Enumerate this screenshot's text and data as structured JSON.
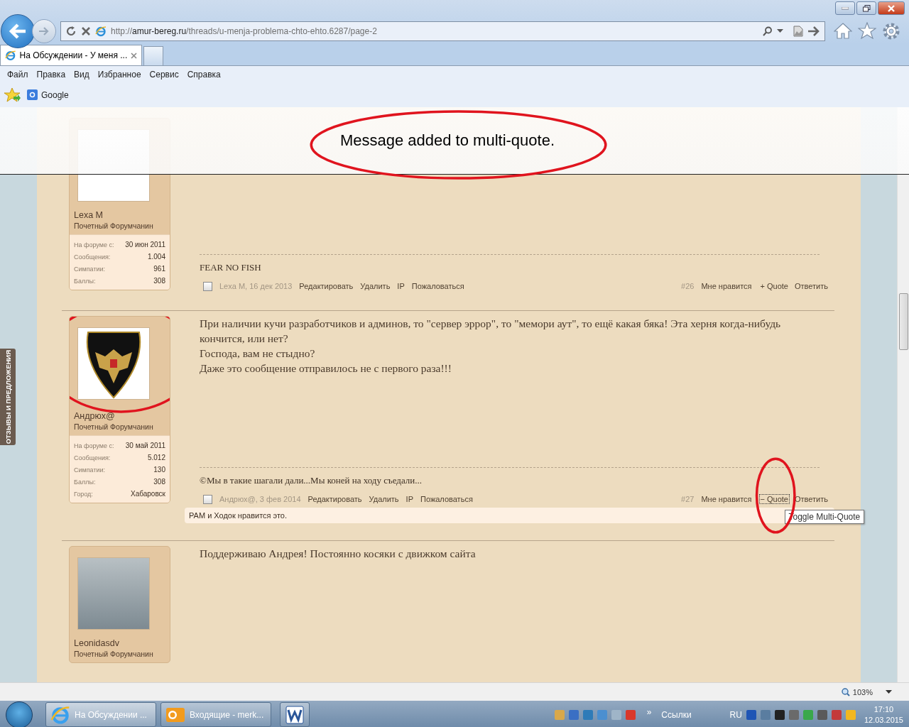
{
  "address_bar": {
    "url_scheme": "http://",
    "url_domain": "amur-bereg.ru",
    "url_path": "/threads/u-menja-problema-chto-ehto.6287/page-2"
  },
  "tabs": [
    {
      "title": "На Обсуждении - У меня ...",
      "selected": true
    }
  ],
  "menu": [
    "Файл",
    "Правка",
    "Вид",
    "Избранное",
    "Сервис",
    "Справка"
  ],
  "favorites_bar": {
    "items": [
      "Google"
    ]
  },
  "feedback_tab": {
    "label": "ОТЗЫВЫ И ПРЕДЛОЖЕНИЯ"
  },
  "notification": {
    "message": "Message added to multi-quote.",
    "circled": true
  },
  "posts": [
    {
      "avatar": {
        "kind": "placeholder",
        "circled": false
      },
      "author": "Lexa M",
      "user_title": "Почетный Форумчанин",
      "stats": [
        {
          "label": "На форуме с:",
          "value": "30 июн 2011"
        },
        {
          "label": "Сообщения:",
          "value": "1.004"
        },
        {
          "label": "Симпатии:",
          "value": "961"
        },
        {
          "label": "Баллы:",
          "value": "308"
        }
      ],
      "signature": "FEAR NO FISH",
      "footer": {
        "checked": false,
        "meta": "Lexa M, 16 дек 2013",
        "actions": [
          "Редактировать",
          "Удалить",
          "IP",
          "Пожаловаться"
        ],
        "number": "#26",
        "like": "Мне нравится",
        "quote": {
          "label": "+ Quote",
          "focused": false,
          "circled": false
        },
        "reply": "Ответить"
      }
    },
    {
      "avatar": {
        "kind": "emblem",
        "circled": true
      },
      "author": "Андрюх@",
      "user_title": "Почетный Форумчанин",
      "stats": [
        {
          "label": "На форуме с:",
          "value": "30 май 2011"
        },
        {
          "label": "Сообщения:",
          "value": "5.012"
        },
        {
          "label": "Симпатии:",
          "value": "130"
        },
        {
          "label": "Баллы:",
          "value": "308"
        },
        {
          "label": "Город:",
          "value": "Хабаровск"
        }
      ],
      "body": [
        "При наличии кучи разработчиков и админов, то \"сервер эррор\", то \"мемори аут\", то ещё какая бяка! Эта херня когда-нибудь кончится, или нет?",
        "Господа, вам не стыдно?",
        "Даже это сообщение отправилось не с первого раза!!!"
      ],
      "signature": "©Мы в такие шагали дали...Мы коней на ходу съедали...",
      "footer": {
        "checked": false,
        "meta": "Андрюх@, 3 фев 2014",
        "actions": [
          "Редактировать",
          "Удалить",
          "IP",
          "Пожаловаться"
        ],
        "number": "#27",
        "like": "Мне нравится",
        "quote": {
          "label": "− Quote",
          "focused": true,
          "circled": true,
          "tooltip": "Toggle Multi-Quote"
        },
        "reply": "Ответить"
      },
      "likes": "РАМ и Ходок нравится это."
    },
    {
      "avatar": {
        "kind": "photo",
        "circled": false
      },
      "author": "Leonidasdv",
      "user_title": "Почетный Форумчанин",
      "body": [
        "Поддерживаю Андрея! Постоянно косяки с движком сайта"
      ]
    }
  ],
  "status_bar": {
    "zoom": "103%"
  },
  "taskbar": {
    "tasks": [
      {
        "kind": "ie",
        "label": "На Обсуждении ...",
        "selected": true
      },
      {
        "kind": "outlook",
        "label": "Входящие - merk...",
        "selected": false
      },
      {
        "kind": "word",
        "selected": false
      }
    ],
    "toolbar_expand": "»",
    "links_label": "Ссылки",
    "language": "RU",
    "time": "17:10",
    "date": "12.03.2015"
  }
}
